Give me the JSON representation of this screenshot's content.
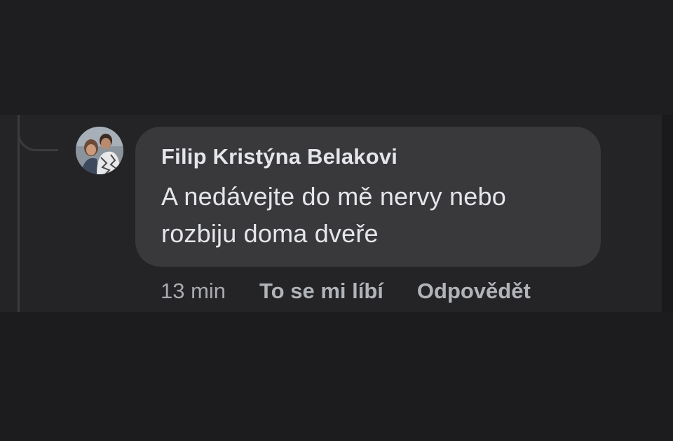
{
  "comment": {
    "author": "Filip Kristýna Belakovi",
    "text": "A nedávejte do mě nervy nebo rozbiju doma dveře",
    "timestamp": "13 min",
    "like_label": "To se mi líbí",
    "reply_label": "Odpovědět"
  },
  "colors": {
    "background": "#1e1e20",
    "bubble": "#39393b",
    "text": "#e4e6eb",
    "secondary_text": "#b0b3b8"
  }
}
